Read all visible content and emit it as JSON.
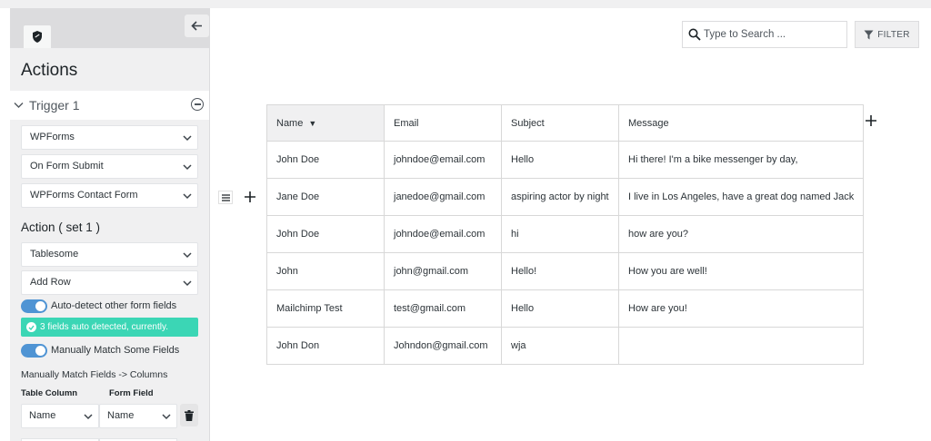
{
  "sidebar": {
    "title": "Actions",
    "trigger_label": "Trigger 1",
    "trigger_selects": [
      "WPForms",
      "On Form Submit",
      "WPForms Contact Form"
    ],
    "action_title": "Action ( set 1 )",
    "action_selects": [
      "Tablesome",
      "Add Row"
    ],
    "autodetect_label": "Auto-detect other form fields",
    "notice": "3 fields auto detected, currently.",
    "manual_label": "Manually Match Some Fields",
    "match_title": "Manually Match Fields -> Columns",
    "col_header_table": "Table Column",
    "col_header_form": "Form Field",
    "map_row": {
      "table_column": "Name",
      "form_field": "Name"
    }
  },
  "toolbar": {
    "search_placeholder": "Type to Search ...",
    "filter_label": "FILTER"
  },
  "table": {
    "columns": [
      "Name",
      "Email",
      "Subject",
      "Message"
    ],
    "rows": [
      [
        "John Doe",
        "johndoe@email.com",
        "Hello",
        "Hi there! I'm a bike messenger by day,"
      ],
      [
        "Jane Doe",
        "janedoe@gmail.com",
        "aspiring actor by night",
        "I live in Los Angeles, have a great dog named Jack"
      ],
      [
        "John Doe",
        "johndoe@email.com",
        "hi",
        "how are you?"
      ],
      [
        "John",
        "john@gmail.com",
        "Hello!",
        "How you are well!"
      ],
      [
        "Mailchimp Test",
        "test@gmail.com",
        "Hello",
        "How are you!"
      ],
      [
        "John Don",
        "Johndon@gmail.com",
        "wja",
        ""
      ]
    ]
  },
  "colors": {
    "accent": "#4f94d4",
    "notice": "#3bd6b5"
  }
}
